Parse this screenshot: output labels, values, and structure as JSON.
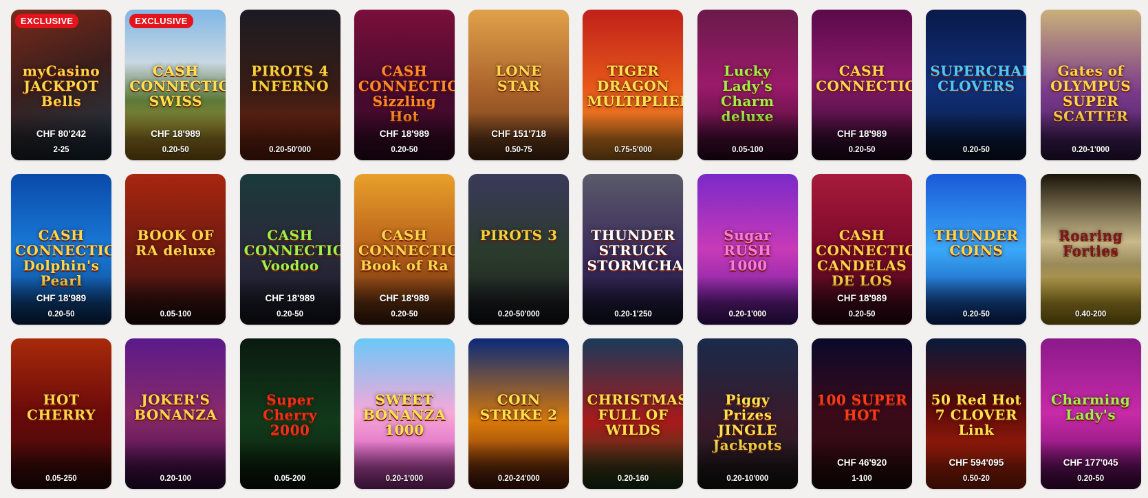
{
  "games": [
    {
      "title": "myCasino JACKPOT Bells",
      "badge": "EXCLUSIVE",
      "jackpot": "CHF 80'242",
      "limits": "2-25",
      "bg": "linear-gradient(160deg,#7a2b1a 0%,#3b1e1c 45%,#1f3a4a 100%)",
      "title_color": "#ffd54a"
    },
    {
      "title": "CASH CONNECTION SWISS",
      "badge": "EXCLUSIVE",
      "jackpot": "CHF 18'989",
      "limits": "0.20-50",
      "bg": "linear-gradient(180deg,#7fb7e6 0%,#c9d7e2 35%,#5c7a3a 60%,#c78d1e 100%)",
      "title_color": "#ffe14d"
    },
    {
      "title": "PIROTS 4 INFERNO",
      "badge": "",
      "jackpot": "",
      "limits": "0.20-50'000",
      "bg": "linear-gradient(180deg,#1b1b22 0%,#3a1c14 55%,#8a2a10 100%)",
      "title_color": "#f2d23b"
    },
    {
      "title": "CASH CONNECTION Sizzling Hot",
      "badge": "",
      "jackpot": "CHF 18'989",
      "limits": "0.20-50",
      "bg": "linear-gradient(180deg,#7a0f3a 0%,#4a0a2e 50%,#3b0a2a 100%)",
      "title_color": "#ff8a2a"
    },
    {
      "title": "LONE STAR",
      "badge": "",
      "jackpot": "CHF 151'718",
      "limits": "0.50-75",
      "bg": "linear-gradient(180deg,#e0a14a 0%,#a8612a 55%,#6b3a1a 100%)",
      "title_color": "#ffd54a"
    },
    {
      "title": "TIGER DRAGON MULTIPLIER",
      "badge": "",
      "jackpot": "",
      "limits": "0.75-5'000",
      "bg": "linear-gradient(180deg,#c0211a 0%,#e5561a 50%,#f29a2a 100%)",
      "title_color": "#ffe14d"
    },
    {
      "title": "Lucky Lady's Charm deluxe",
      "badge": "",
      "jackpot": "",
      "limits": "0.05-100",
      "bg": "linear-gradient(180deg,#6a1a4a 0%,#9b1a6b 50%,#3a0a2a 100%)",
      "title_color": "#9ef04a"
    },
    {
      "title": "CASH CONNECTION",
      "badge": "",
      "jackpot": "CHF 18'989",
      "limits": "0.20-50",
      "bg": "linear-gradient(180deg,#5a0a4a 0%,#8a1a6a 45%,#2a0a2a 100%)",
      "title_color": "#ffd54a"
    },
    {
      "title": "SUPERCHARGED CLOVERS",
      "badge": "",
      "jackpot": "",
      "limits": "0.20-50",
      "bg": "linear-gradient(180deg,#0a1a4a 0%,#10307a 50%,#0a1a3a 100%)",
      "title_color": "#4ac8ff"
    },
    {
      "title": "Gates of OLYMPUS SUPER SCATTER",
      "badge": "",
      "jackpot": "",
      "limits": "0.20-1'000",
      "bg": "linear-gradient(180deg,#c9b07a 0%,#7a3a8a 55%,#3a1a5a 100%)",
      "title_color": "#ffd54a"
    },
    {
      "title": "CASH CONNECTION Dolphin's Pearl",
      "badge": "",
      "jackpot": "CHF 18'989",
      "limits": "0.20-50",
      "bg": "linear-gradient(180deg,#0a4aa8 0%,#1a7ad8 50%,#0a3a7a 100%)",
      "title_color": "#ffd54a"
    },
    {
      "title": "BOOK OF RA deluxe",
      "badge": "",
      "jackpot": "",
      "limits": "0.05-100",
      "bg": "linear-gradient(180deg,#a8260f 0%,#6a1a10 55%,#2a1010 100%)",
      "title_color": "#ffd54a"
    },
    {
      "title": "CASH CONNECTION Voodoo",
      "badge": "",
      "jackpot": "CHF 18'989",
      "limits": "0.20-50",
      "bg": "linear-gradient(180deg,#1a3a3a 0%,#2a2a3a 50%,#1a1a2a 100%)",
      "title_color": "#9ef04a"
    },
    {
      "title": "CASH CONNECTION Book of Ra",
      "badge": "",
      "jackpot": "CHF 18'989",
      "limits": "0.20-50",
      "bg": "linear-gradient(180deg,#e8a02a 0%,#b8601a 50%,#5a2a10 100%)",
      "title_color": "#ffd54a"
    },
    {
      "title": "PIROTS 3",
      "badge": "",
      "jackpot": "",
      "limits": "0.20-50'000",
      "bg": "linear-gradient(180deg,#3a3a5a 0%,#2a3a2a 55%,#1a1a22 100%)",
      "title_color": "#f2d23b"
    },
    {
      "title": "THUNDER STRUCK STORMCHASER",
      "badge": "",
      "jackpot": "",
      "limits": "0.20-1'250",
      "bg": "linear-gradient(180deg,#5a5a6a 0%,#3a2a5a 55%,#1a1a3a 100%)",
      "title_color": "#ffffff"
    },
    {
      "title": "Sugar RUSH 1000",
      "badge": "",
      "jackpot": "",
      "limits": "0.20-1'000",
      "bg": "linear-gradient(180deg,#7a2ac8 0%,#c83ab8 50%,#5a1a9a 100%)",
      "title_color": "#ff7ad8"
    },
    {
      "title": "CASH CONNECTION CANDELAS DE LOS",
      "badge": "",
      "jackpot": "CHF 18'989",
      "limits": "0.20-50",
      "bg": "linear-gradient(180deg,#a81a3a 0%,#7a0a2a 50%,#3a0a1a 100%)",
      "title_color": "#ffd54a"
    },
    {
      "title": "THUNDER COINS",
      "badge": "",
      "jackpot": "",
      "limits": "0.20-50",
      "bg": "linear-gradient(180deg,#1a5ad8 0%,#3aa8f8 50%,#0a3a9a 100%)",
      "title_color": "#ffd54a"
    },
    {
      "title": "Roaring Forties",
      "badge": "",
      "jackpot": "",
      "limits": "0.40-200",
      "bg": "linear-gradient(180deg,#1a140a 0%,#c9b98a 45%,#9a8a5a 60%,#d8b01a 100%)",
      "title_color": "#7a1a1a"
    },
    {
      "title": "HOT CHERRY",
      "badge": "",
      "jackpot": "",
      "limits": "0.05-250",
      "bg": "linear-gradient(180deg,#a82a0a 0%,#6a0a0a 50%,#3a0a0a 100%)",
      "title_color": "#ffd54a"
    },
    {
      "title": "JOKER'S BONANZA",
      "badge": "",
      "jackpot": "",
      "limits": "0.20-100",
      "bg": "linear-gradient(180deg,#5a1a8a 0%,#8a2a6a 50%,#3a0a4a 100%)",
      "title_color": "#ffd54a"
    },
    {
      "title": "Super Cherry 2000",
      "badge": "",
      "jackpot": "",
      "limits": "0.05-200",
      "bg": "linear-gradient(180deg,#0a1a10 0%,#123a1a 55%,#0a1a0a 100%)",
      "title_color": "#f0301a"
    },
    {
      "title": "SWEET BONANZA 1000",
      "badge": "",
      "jackpot": "",
      "limits": "0.20-1'000",
      "bg": "linear-gradient(180deg,#6ac8f8 0%,#f8a8d8 50%,#c83ab8 100%)",
      "title_color": "#ffe14d"
    },
    {
      "title": "COIN STRIKE 2",
      "badge": "",
      "jackpot": "",
      "limits": "0.20-24'000",
      "bg": "linear-gradient(180deg,#0a2a7a 0%,#d87a0a 55%,#5a1a0a 100%)",
      "title_color": "#ffe14d"
    },
    {
      "title": "CHRISTMAS FULL OF WILDS",
      "badge": "",
      "jackpot": "",
      "limits": "0.20-160",
      "bg": "linear-gradient(180deg,#1a3a5a 0%,#a81a1a 55%,#1a4a1a 100%)",
      "title_color": "#ffe14d"
    },
    {
      "title": "Piggy Prizes JINGLE Jackpots",
      "badge": "",
      "jackpot": "",
      "limits": "0.20-10'000",
      "bg": "linear-gradient(180deg,#1a2a4a 0%,#3a1a2a 55%,#1a1a1a 100%)",
      "title_color": "#ffe14d"
    },
    {
      "title": "100 SUPER HOT",
      "badge": "",
      "jackpot": "CHF 46'920",
      "limits": "1-100",
      "bg": "linear-gradient(180deg,#0a0a2a 0%,#3a0a1a 50%,#2a0a0a 100%)",
      "title_color": "#ff3a1a"
    },
    {
      "title": "50 Red Hot 7 CLOVER Link",
      "badge": "",
      "jackpot": "CHF 594'095",
      "limits": "0.50-20",
      "bg": "linear-gradient(180deg,#0a1a3a 0%,#5a0a0a 45%,#c82a0a 100%)",
      "title_color": "#ffe14d"
    },
    {
      "title": "Charming Lady's",
      "badge": "",
      "jackpot": "CHF 177'045",
      "limits": "0.20-50",
      "bg": "linear-gradient(180deg,#8a1a8a 0%,#c82aa8 50%,#5a0a5a 100%)",
      "title_color": "#9ef04a"
    }
  ]
}
